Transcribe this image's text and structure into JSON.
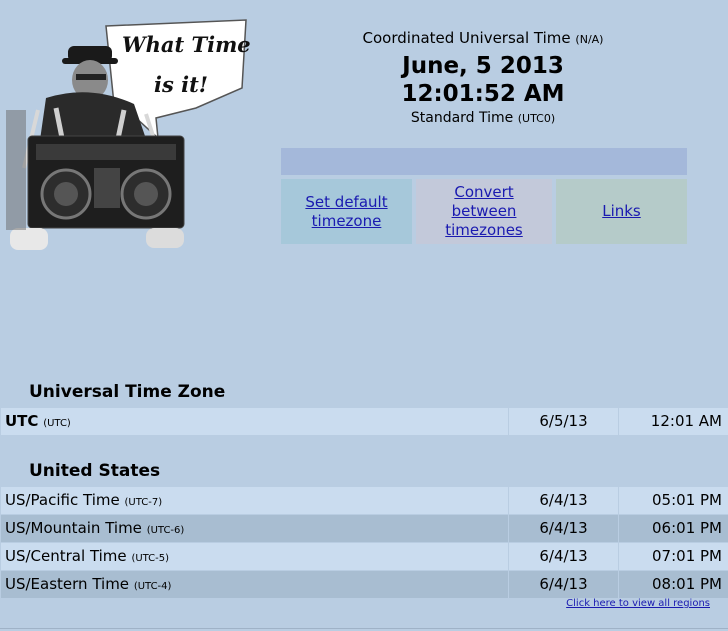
{
  "logo": {
    "speech_text_1": "What Time",
    "speech_text_2": "is it!"
  },
  "header": {
    "tz_name": "Coordinated Universal Time",
    "tz_abbrev": "(N/A)",
    "date": "June, 5 2013",
    "time": "12:01:52 AM",
    "std_label": "Standard Time",
    "std_offset": "(UTC0)"
  },
  "nav": {
    "set_default": "Set default timezone",
    "convert": "Convert between timezones",
    "links": "Links"
  },
  "sections": [
    {
      "title": "Universal Time Zone",
      "rows": [
        {
          "name": "UTC",
          "offset": "(UTC)",
          "date": "6/5/13",
          "time": "12:01 AM"
        }
      ]
    },
    {
      "title": "United States",
      "rows": [
        {
          "name": "US/Pacific Time",
          "offset": "(UTC-7)",
          "date": "6/4/13",
          "time": "05:01 PM"
        },
        {
          "name": "US/Mountain Time",
          "offset": "(UTC-6)",
          "date": "6/4/13",
          "time": "06:01 PM"
        },
        {
          "name": "US/Central Time",
          "offset": "(UTC-5)",
          "date": "6/4/13",
          "time": "07:01 PM"
        },
        {
          "name": "US/Eastern Time",
          "offset": "(UTC-4)",
          "date": "6/4/13",
          "time": "08:01 PM"
        }
      ]
    }
  ],
  "view_all": "Click here to view all regions"
}
